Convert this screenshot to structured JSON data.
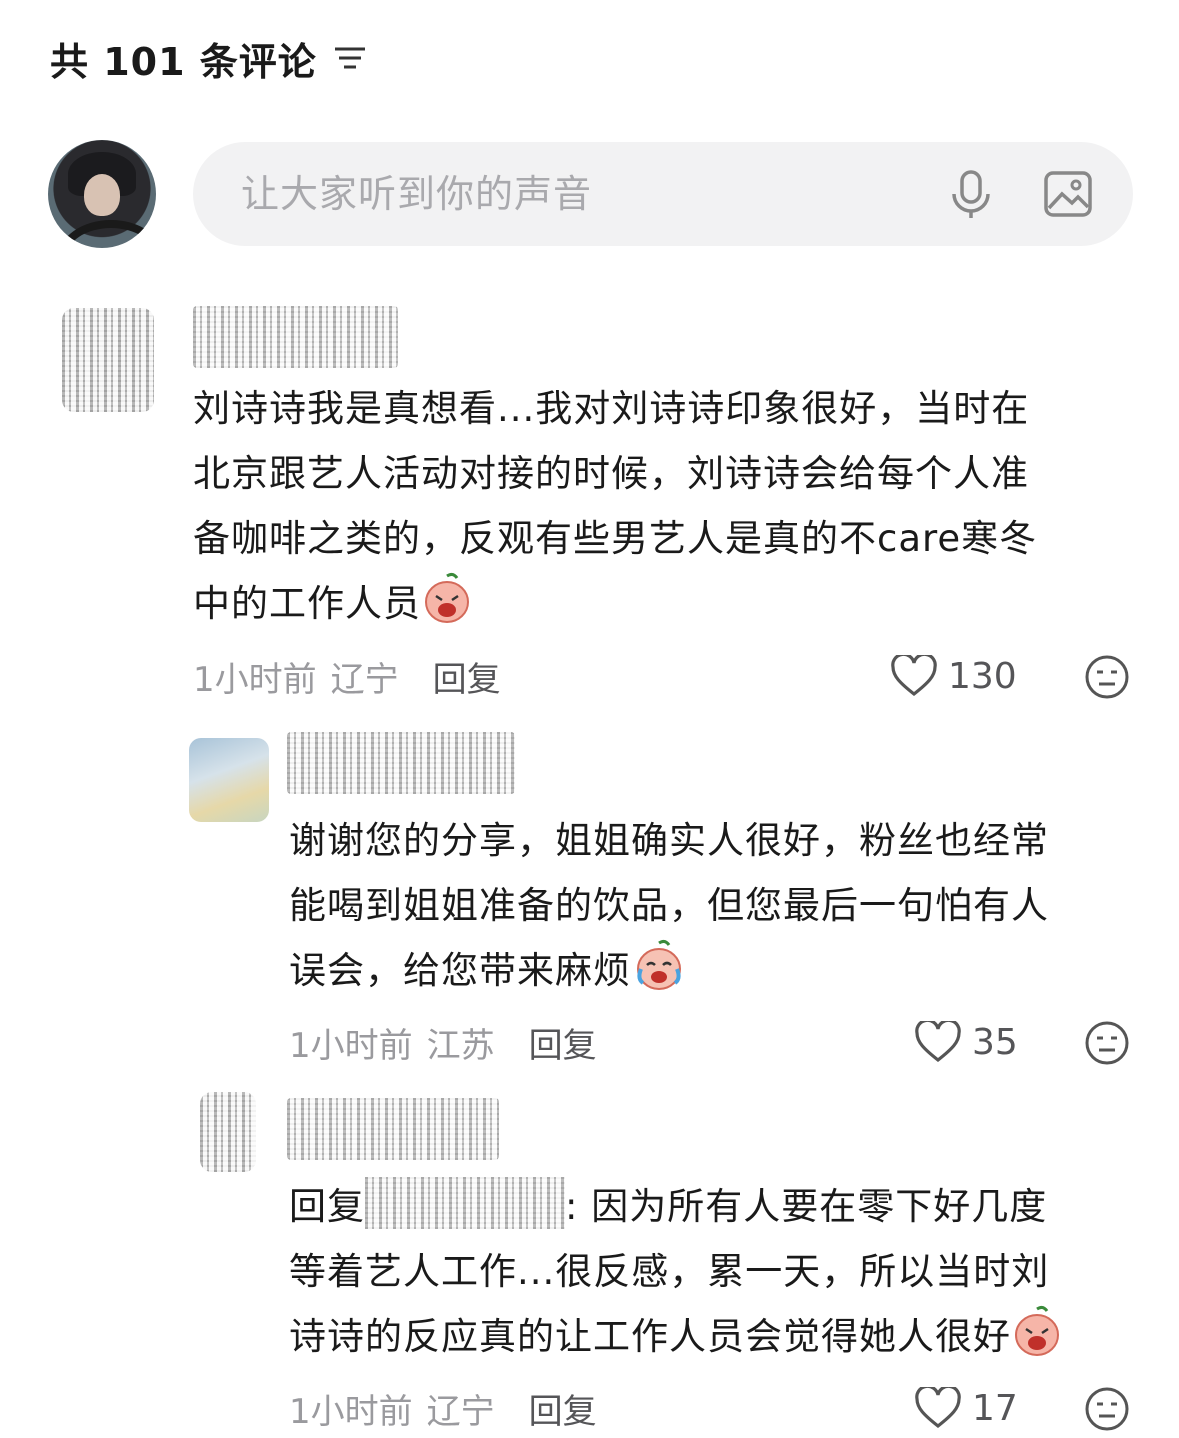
{
  "header": {
    "title": "共 101 条评论"
  },
  "composer": {
    "placeholder": "让大家听到你的声音"
  },
  "comments": [
    {
      "text_lines": [
        "刘诗诗我是真想看...我对刘诗诗印象很好，当时在",
        "北京跟艺人活动对接的时候，刘诗诗会给每个人准",
        "备咖啡之类的，反观有些男艺人是真的不care寒冬",
        "中的工作人员"
      ],
      "time": "1小时前",
      "location": "辽宁",
      "reply_label": "回复",
      "likes": "130"
    },
    {
      "text_lines": [
        "谢谢您的分享，姐姐确实人很好，粉丝也经常",
        "能喝到姐姐准备的饮品，但您最后一句怕有人",
        "误会，给您带来麻烦"
      ],
      "time": "1小时前",
      "location": "江苏",
      "reply_label": "回复",
      "likes": "35"
    },
    {
      "reply_prefix": "回复",
      "text_lines": [
        ": 因为所有人要在零下好几度",
        "等着艺人工作...很反感，累一天，所以当时刘",
        "诗诗的反应真的让工作人员会觉得她人很好"
      ],
      "time": "1小时前",
      "location": "辽宁",
      "reply_label": "回复",
      "likes": "17"
    }
  ]
}
